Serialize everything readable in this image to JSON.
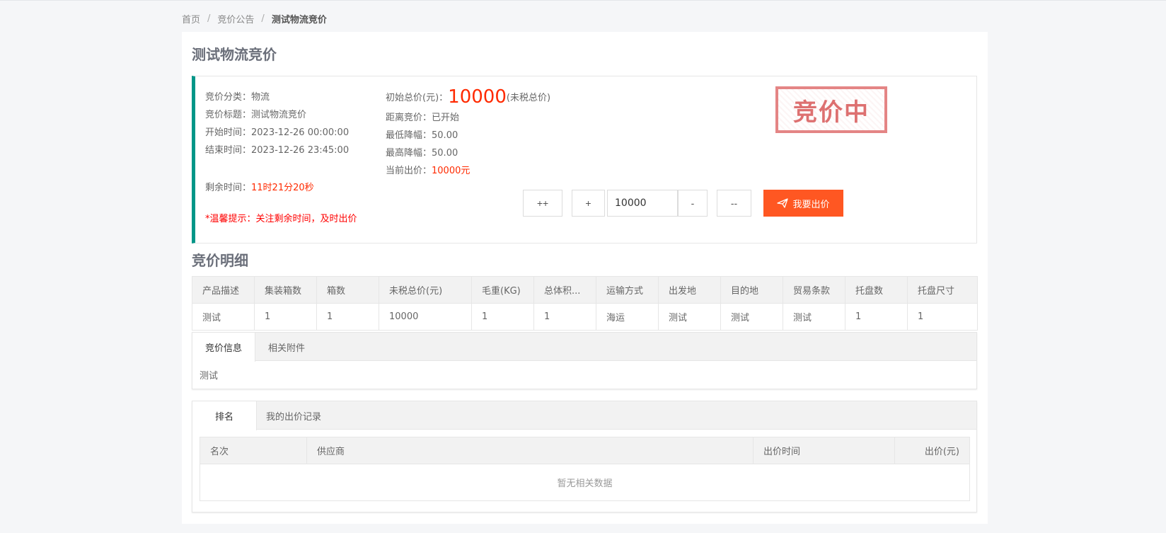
{
  "breadcrumb": {
    "home": "首页",
    "list": "竞价公告",
    "current": "测试物流竞价",
    "separator": "/"
  },
  "page_title": "测试物流竞价",
  "info": {
    "category_label": "竞价分类：",
    "category_value": "物流",
    "title_label": "竞价标题：",
    "title_value": "测试物流竞价",
    "start_label": "开始时间：",
    "start_value": "2023-12-26 00:00:00",
    "end_label": "结束时间：",
    "end_value": "2023-12-26 23:45:00",
    "remaining_label": "剩余时间：",
    "remaining_value": "11时21分20秒",
    "tip": "*温馨提示：关注剩余时间，及时出价",
    "initial_label": "初始总价(元)：",
    "initial_value": "10000",
    "initial_note": "(未税总价)",
    "distance_label": "距离竞价：",
    "distance_value": "已开始",
    "min_drop_label": "最低降幅：",
    "min_drop_value": "50.00",
    "max_drop_label": "最高降幅：",
    "max_drop_value": "50.00",
    "current_label": "当前出价：",
    "current_value": "10000元",
    "stamp": "竞价中"
  },
  "bid": {
    "plus_plus": "++",
    "plus": "+",
    "amount": "10000",
    "minus": "-",
    "minus_minus": "--",
    "submit": "我要出价",
    "accent_color": "#ff5722"
  },
  "detail": {
    "title": "竞价明细",
    "headers": [
      "产品描述",
      "集装箱数",
      "箱数",
      "未税总价(元)",
      "毛重(KG)",
      "总体积...",
      "运输方式",
      "出发地",
      "目的地",
      "贸易条款",
      "托盘数",
      "托盘尺寸"
    ],
    "rows": [
      [
        "测试",
        "1",
        "1",
        "10000",
        "1",
        "1",
        "海运",
        "测试",
        "测试",
        "测试",
        "1",
        "1"
      ]
    ]
  },
  "info_tabs": {
    "tabs": [
      "竞价信息",
      "相关附件"
    ],
    "content": "测试"
  },
  "rank_tabs": {
    "tabs": [
      "排名",
      "我的出价记录"
    ],
    "headers": [
      "名次",
      "供应商",
      "出价时间",
      "出价(元)"
    ],
    "empty": "暂无相关数据"
  }
}
